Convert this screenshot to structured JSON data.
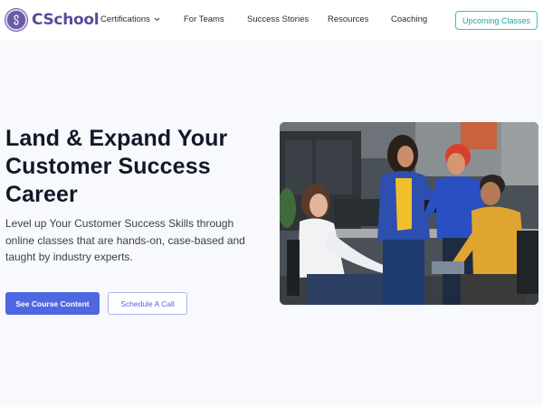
{
  "brand": {
    "name": "CSchool",
    "logo_icon": "brand-logo-icon",
    "color": "#5a4a9a"
  },
  "nav": {
    "items": [
      {
        "label": "Certifications",
        "has_dropdown": true
      },
      {
        "label": "For Teams"
      },
      {
        "label": "Success Stories"
      },
      {
        "label": "Resources"
      },
      {
        "label": "Coaching"
      }
    ],
    "cta_label": "Upcoming Classes",
    "cta_color": "#2cc7c4"
  },
  "hero": {
    "title_lines": [
      "Land & Expand Your",
      "Customer Success",
      "Career"
    ],
    "description_lines": [
      "Level up Your Customer Success Skills through",
      "online classes that are hands-on, case-based and",
      "taught by industry experts."
    ],
    "primary_button": "See Course Content",
    "secondary_button": "Schedule A Call",
    "primary_color": "#4f67e0",
    "image_icon": "team-photo"
  }
}
